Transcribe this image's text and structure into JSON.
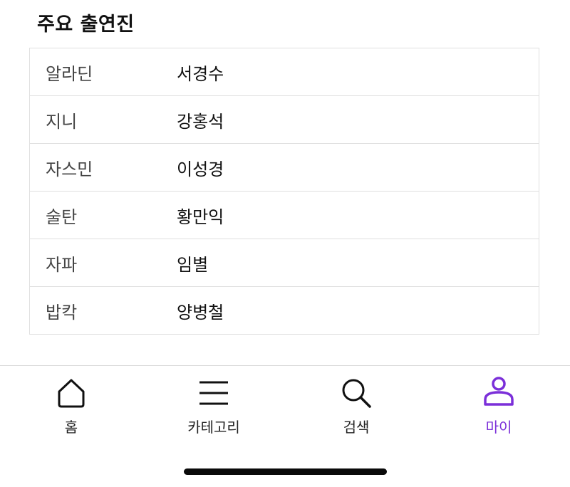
{
  "section": {
    "title": "주요 출연진"
  },
  "cast": [
    {
      "role": "알라딘",
      "actor": "서경수"
    },
    {
      "role": "지니",
      "actor": "강홍석"
    },
    {
      "role": "자스민",
      "actor": "이성경"
    },
    {
      "role": "술탄",
      "actor": "황만익"
    },
    {
      "role": "자파",
      "actor": "임별"
    },
    {
      "role": "밥칵",
      "actor": "양병철"
    }
  ],
  "nav": {
    "items": [
      {
        "label": "홈",
        "icon": "home-icon"
      },
      {
        "label": "카테고리",
        "icon": "menu-icon"
      },
      {
        "label": "검색",
        "icon": "search-icon"
      },
      {
        "label": "마이",
        "icon": "person-icon"
      }
    ],
    "active_index": 3
  },
  "colors": {
    "accent": "#7b2fd9",
    "border": "#e0e0e0",
    "text": "#111111",
    "muted_text": "#444444"
  }
}
